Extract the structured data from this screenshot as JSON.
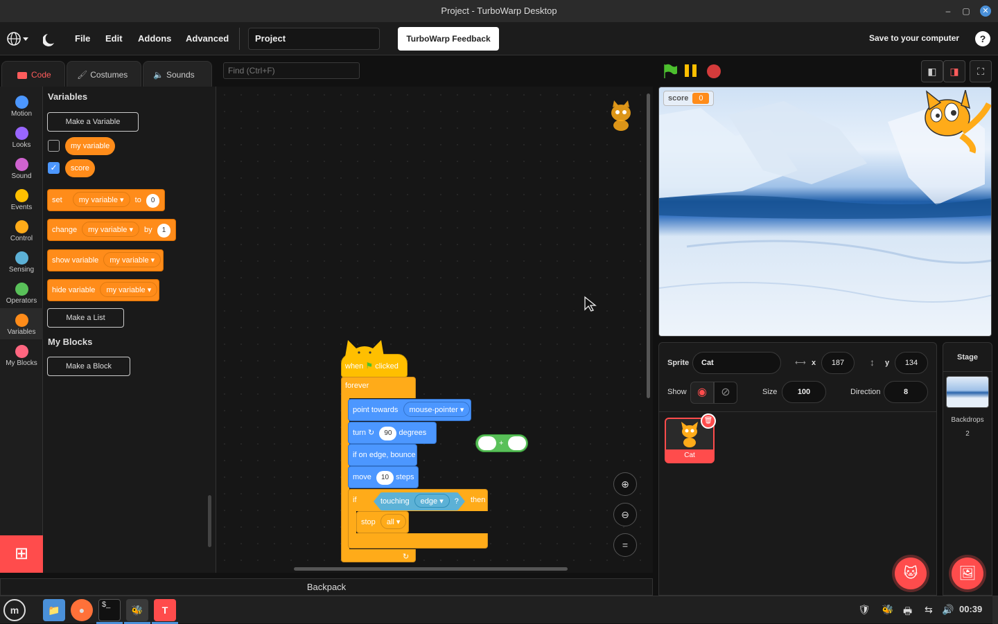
{
  "window": {
    "title": "Project - TurboWarp Desktop",
    "minimize": "–",
    "maximize": "▢",
    "close": "✕"
  },
  "menubar": {
    "globe_icon": "globe-icon",
    "items": [
      "File",
      "Edit",
      "Addons",
      "Advanced"
    ],
    "project_name": "Project",
    "feedback_label": "TurboWarp Feedback",
    "save_label": "Save to your computer",
    "help": "?"
  },
  "tabs": [
    {
      "label": "Code",
      "icon": "code-icon"
    },
    {
      "label": "Costumes",
      "icon": "brush-icon"
    },
    {
      "label": "Sounds",
      "icon": "speaker-icon"
    }
  ],
  "find": {
    "placeholder": "Find (Ctrl+F)"
  },
  "categories": [
    {
      "label": "Motion",
      "color": "#4c97ff"
    },
    {
      "label": "Looks",
      "color": "#9966ff"
    },
    {
      "label": "Sound",
      "color": "#cf63cf"
    },
    {
      "label": "Events",
      "color": "#ffbf00"
    },
    {
      "label": "Control",
      "color": "#ffab19"
    },
    {
      "label": "Sensing",
      "color": "#5cb1d6"
    },
    {
      "label": "Operators",
      "color": "#59c059"
    },
    {
      "label": "Variables",
      "color": "#ff8c1a"
    },
    {
      "label": "My Blocks",
      "color": "#ff6680"
    }
  ],
  "palette": {
    "variables_title": "Variables",
    "make_variable": "Make a Variable",
    "var1": "my variable",
    "var2": "score",
    "set_block": {
      "kw": "set",
      "var": "my variable",
      "to": "to",
      "val": "0"
    },
    "change_block": {
      "kw": "change",
      "var": "my variable",
      "by": "by",
      "val": "1"
    },
    "show_block": {
      "kw": "show variable",
      "var": "my variable"
    },
    "hide_block": {
      "kw": "hide variable",
      "var": "my variable"
    },
    "make_list": "Make a List",
    "myblocks_title": "My Blocks",
    "make_block": "Make a Block"
  },
  "script": {
    "hat_when": "when",
    "hat_clicked": "clicked",
    "forever": "forever",
    "point_towards": "point towards",
    "point_target": "mouse-pointer",
    "turn": "turn",
    "turn_val": "90",
    "degrees": "degrees",
    "bounce": "if on edge, bounce",
    "move": "move",
    "move_val": "10",
    "steps": "steps",
    "if": "if",
    "touching": "touching",
    "touching_target": "edge",
    "q": "?",
    "then": "then",
    "stop": "stop",
    "stop_opt": "all",
    "plus": "+"
  },
  "backpack": "Backpack",
  "stage": {
    "monitor_label": "score",
    "monitor_value": "0"
  },
  "sprite_info": {
    "sprite_label": "Sprite",
    "sprite_name": "Cat",
    "x_label": "x",
    "x": "187",
    "y_label": "y",
    "y": "134",
    "show_label": "Show",
    "size_label": "Size",
    "size": "100",
    "direction_label": "Direction",
    "direction": "8"
  },
  "sprites": [
    {
      "name": "Cat"
    }
  ],
  "stage_pane": {
    "title": "Stage",
    "backdrops_label": "Backdrops",
    "backdrops_count": "2"
  },
  "taskbar": {
    "clock": "00:39"
  }
}
